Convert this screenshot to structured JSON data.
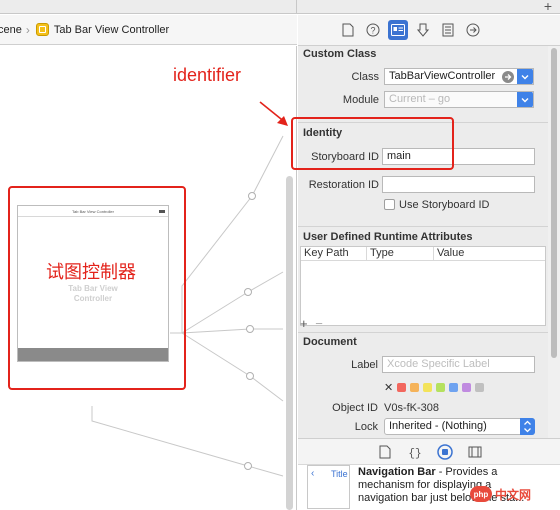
{
  "jumpbar": {
    "crumb_scene": "cene",
    "crumb_controller": "Tab Bar View Controller"
  },
  "canvas": {
    "scene_nav_title": "Tab Bar View Controller",
    "scene_body_text": "Tab Bar View Controller"
  },
  "annotations": {
    "identifier_label": "identifier",
    "scene_label_cn": "试图控制器",
    "color": "#e3231b"
  },
  "inspector_toolbar": {
    "icons": [
      "file-icon",
      "help-icon",
      "identity-icon",
      "attributes-icon",
      "size-icon",
      "connections-icon"
    ],
    "selected": "identity-icon"
  },
  "custom_class": {
    "title": "Custom Class",
    "class_label": "Class",
    "class_value": "TabBarViewController",
    "module_label": "Module",
    "module_value": "Current – go"
  },
  "identity": {
    "title": "Identity",
    "storyboard_id_label": "Storyboard ID",
    "storyboard_id_value": "main",
    "restoration_id_label": "Restoration ID",
    "restoration_id_value": "",
    "use_storyboard_id_label": "Use Storyboard ID",
    "use_storyboard_id_checked": false
  },
  "udra": {
    "title": "User Defined Runtime Attributes",
    "columns": [
      "Key Path",
      "Type",
      "Value"
    ],
    "add_symbol": "+",
    "remove_symbol": "−"
  },
  "document": {
    "title": "Document",
    "label_label": "Label",
    "label_placeholder": "Xcode Specific Label",
    "remove_color_symbol": "✕",
    "label_colors": [
      "#f2675e",
      "#f5b35a",
      "#f3e35a",
      "#b5e15e",
      "#6fa3f0",
      "#c08be0",
      "#c0c0c0"
    ],
    "object_id_label": "Object ID",
    "object_id_value": "V0s-fK-308",
    "lock_label": "Lock",
    "lock_value": "Inherited - (Nothing)"
  },
  "library": {
    "icons": [
      "file-template-icon",
      "code-snippet-icon",
      "object-library-icon",
      "media-library-icon"
    ],
    "selected": "object-library-icon",
    "item_thumb_back": "‹",
    "item_thumb_title": "Title",
    "item_name": "Navigation Bar",
    "item_desc": " - Provides a mechanism for displaying a navigation bar just below the sta..."
  },
  "watermark": {
    "logo_text": "php",
    "site_text": "中文网"
  }
}
